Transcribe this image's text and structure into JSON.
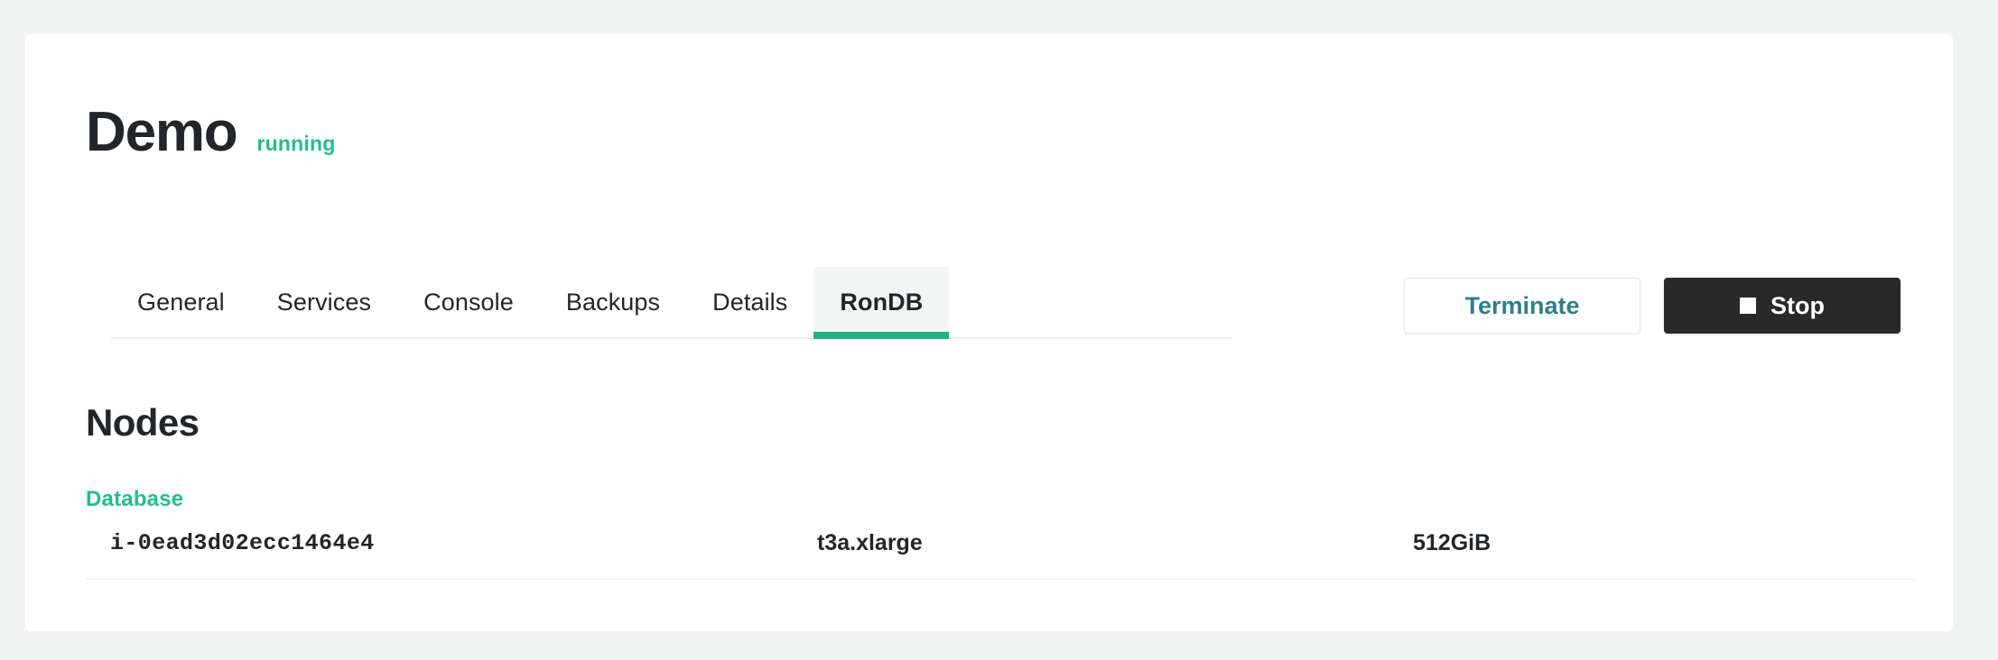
{
  "header": {
    "title": "Demo",
    "status": "running"
  },
  "tabs": [
    {
      "label": "General",
      "active": false
    },
    {
      "label": "Services",
      "active": false
    },
    {
      "label": "Console",
      "active": false
    },
    {
      "label": "Backups",
      "active": false
    },
    {
      "label": "Details",
      "active": false
    },
    {
      "label": "RonDB",
      "active": true
    }
  ],
  "actions": {
    "terminate_label": "Terminate",
    "stop_label": "Stop",
    "stop_icon": "square-stop-icon"
  },
  "nodes": {
    "section_title": "Nodes",
    "group_label": "Database",
    "rows": [
      {
        "instance_id": "i-0ead3d02ecc1464e4",
        "instance_type": "t3a.xlarge",
        "storage": "512GiB"
      }
    ]
  },
  "colors": {
    "accent_green": "#20bf8f",
    "tab_underline": "#20b183",
    "link_blue": "#2d7f8e",
    "dark": "#292929",
    "page_bg": "#f2f3f3"
  }
}
